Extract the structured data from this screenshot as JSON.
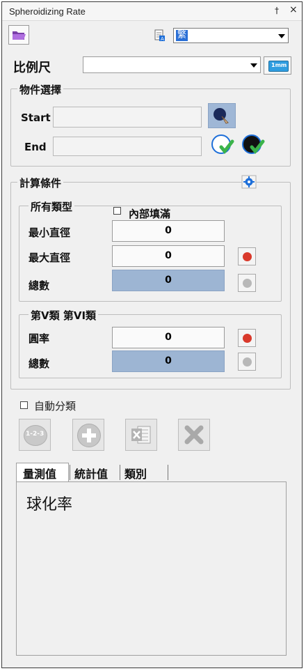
{
  "window": {
    "title": "Spheroidizing Rate",
    "pin_glyph": "†",
    "close_glyph": "×"
  },
  "toolbar": {
    "open_icon": "folder-open-icon",
    "language_icon": "language-icon",
    "language_value": "繁"
  },
  "scale": {
    "label": "比例尺",
    "value": "",
    "ruler_icon": "ruler-icon",
    "ruler_text": "1mm"
  },
  "object_select": {
    "legend": "物件選擇",
    "start_label": "Start",
    "start_value": "",
    "end_label": "End",
    "end_value": ""
  },
  "calc": {
    "legend": "計算條件",
    "settings_icon": "gear-icon",
    "all_types": {
      "legend": "所有類型",
      "fill_label": "內部填滿",
      "fill_checked": false,
      "min_diameter_label": "最小直徑",
      "min_diameter_value": "0",
      "max_diameter_label": "最大直徑",
      "max_diameter_value": "0",
      "total_label": "總數",
      "total_value": "0"
    },
    "type56": {
      "legend": "第V類 第VI類",
      "roundness_label": "圓率",
      "roundness_value": "0",
      "total_label": "總數",
      "total_value": "0"
    }
  },
  "auto_classify": {
    "label": "自動分類",
    "checked": false
  },
  "actions": {
    "number_text": "1-2-3"
  },
  "tabs": [
    {
      "label": "量測值"
    },
    {
      "label": "統計值"
    },
    {
      "label": "類別"
    }
  ],
  "content": {
    "heading": "球化率"
  },
  "colors": {
    "accent_blue": "#9db5d3",
    "red_dot": "#d9392b",
    "check_green": "#3bb34a",
    "icon_blue": "#1e6fd9"
  }
}
